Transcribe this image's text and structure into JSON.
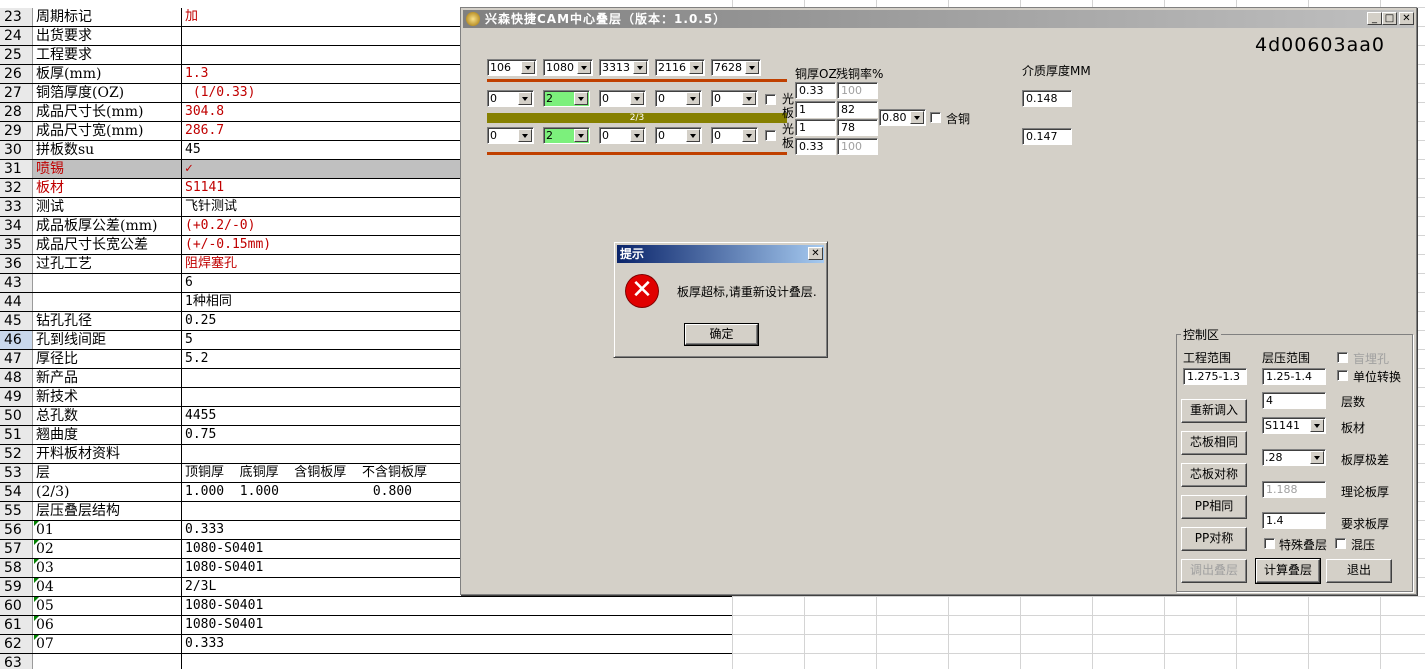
{
  "sheet": {
    "rows": [
      {
        "num": "23",
        "a": "周期标记",
        "b": "加",
        "a_red": false,
        "b_red": true
      },
      {
        "num": "24",
        "a": "出货要求",
        "b": ""
      },
      {
        "num": "25",
        "a": "工程要求",
        "b": ""
      },
      {
        "num": "26",
        "a": "板厚(mm)",
        "b": "1.3",
        "b_red": true
      },
      {
        "num": "27",
        "a": "铜箔厚度(OZ)",
        "b": " (1/0.33)",
        "b_red": true
      },
      {
        "num": "28",
        "a": "成品尺寸长(mm)",
        "b": "304.8",
        "b_red": true
      },
      {
        "num": "29",
        "a": "成品尺寸宽(mm)",
        "b": "286.7",
        "b_red": true
      },
      {
        "num": "30",
        "a": "拼板数su",
        "b": "45"
      },
      {
        "num": "31",
        "a": "喷锡",
        "b": "✓",
        "a_red": true,
        "b_red": true,
        "sel": true
      },
      {
        "num": "32",
        "a": "板材",
        "b": "S1141",
        "a_red": true,
        "b_red": true
      },
      {
        "num": "33",
        "a": "测试",
        "b": "飞针测试"
      },
      {
        "num": "34",
        "a": "成品板厚公差(mm)",
        "b": "(+0.2/-0)",
        "b_red": true
      },
      {
        "num": "35",
        "a": "成品尺寸长宽公差",
        "b": "(+/-0.15mm)",
        "b_red": true
      },
      {
        "num": "36",
        "a": "过孔工艺",
        "b": "阻焊塞孔",
        "b_red": true
      },
      {
        "num": "43",
        "a": "",
        "b": "6"
      },
      {
        "num": "44",
        "a": "",
        "b": "1种相同"
      },
      {
        "num": "45",
        "a": "钻孔孔径",
        "b": "0.25"
      },
      {
        "num": "46",
        "a": "孔到线间距",
        "b": "5",
        "hl": true
      },
      {
        "num": "47",
        "a": "厚径比",
        "b": "5.2"
      },
      {
        "num": "48",
        "a": "新产品",
        "b": ""
      },
      {
        "num": "49",
        "a": "新技术",
        "b": ""
      },
      {
        "num": "50",
        "a": "总孔数",
        "b": "4455"
      },
      {
        "num": "51",
        "a": "翘曲度",
        "b": "0.75"
      },
      {
        "num": "52",
        "a": "开料板材资料",
        "b": ""
      },
      {
        "num": "53",
        "a": "层",
        "b": "顶铜厚  底铜厚  含铜板厚  不含铜板厚 "
      },
      {
        "num": "54",
        "a": "(2/3)",
        "b": "1.000  1.000            0.800"
      },
      {
        "num": "55",
        "a": "层压叠层结构",
        "b": ""
      },
      {
        "num": "56",
        "a": "01",
        "b": "0.333",
        "tri": true
      },
      {
        "num": "57",
        "a": "02",
        "b": "1080-S0401",
        "tri": true
      },
      {
        "num": "58",
        "a": "03",
        "b": "1080-S0401",
        "tri": true
      },
      {
        "num": "59",
        "a": "04",
        "b": "2/3L",
        "tri": true
      },
      {
        "num": "60",
        "a": "05",
        "b": "1080-S0401",
        "tri": true
      },
      {
        "num": "61",
        "a": "06",
        "b": "1080-S0401",
        "tri": true
      },
      {
        "num": "62",
        "a": "07",
        "b": "0.333",
        "tri": true
      },
      {
        "num": "63",
        "a": "",
        "b": ""
      }
    ]
  },
  "window": {
    "title": "兴森快捷CAM中心叠层（版本：1.0.5）",
    "code": "4d00603aa0",
    "top_combos": [
      "106",
      "1080",
      "3313",
      "2116",
      "7628"
    ],
    "layer1_combos": [
      "0",
      "2",
      "0",
      "0",
      "0"
    ],
    "layer2_combos": [
      "0",
      "2",
      "0",
      "0",
      "0"
    ],
    "bar_label": "2/3",
    "guang_ban": "光板",
    "col_headers": {
      "copper_oz": "铜厚OZ",
      "residual": "残铜率%",
      "dielectric": "介质厚度MM"
    },
    "copper_values": [
      "0.33",
      "1",
      "1",
      "0.33"
    ],
    "residual_values": [
      "100",
      "82",
      "78",
      "100"
    ],
    "ratio_combo": "0.80",
    "han_tong": "含铜",
    "dielectric_values": [
      "0.148",
      "0.147"
    ]
  },
  "control": {
    "group_label": "控制区",
    "project_range_label": "工程范围",
    "project_range": "1.275-1.3",
    "press_range_label": "层压范围",
    "press_range": "1.25-1.4",
    "blind_hole": "盲埋孔",
    "unit_convert": "单位转换",
    "layers_value": "4",
    "layers_label": "层数",
    "material_value": "S1141",
    "material_label": "板材",
    "tol_value": ".28",
    "tol_label": "板厚极差",
    "theory_value": "1.188",
    "theory_label": "理论板厚",
    "required_value": "1.4",
    "required_label": "要求板厚",
    "special_stack": "特殊叠层",
    "mixed_press": "混压",
    "buttons": {
      "reload": "重新调入",
      "core_same": "芯板相同",
      "core_sym": "芯板对称",
      "pp_same": "PP相同",
      "pp_sym": "PP对称",
      "export": "调出叠层",
      "calc": "计算叠层",
      "exit": "退出"
    }
  },
  "dialog": {
    "title": "提示",
    "message": "板厚超标,请重新设计叠层.",
    "ok": "确定"
  },
  "colors": {
    "orange_line": "#c04000",
    "olive_bar": "#868000",
    "green_combo": "#7cf07c",
    "error_red": "#e00000"
  }
}
